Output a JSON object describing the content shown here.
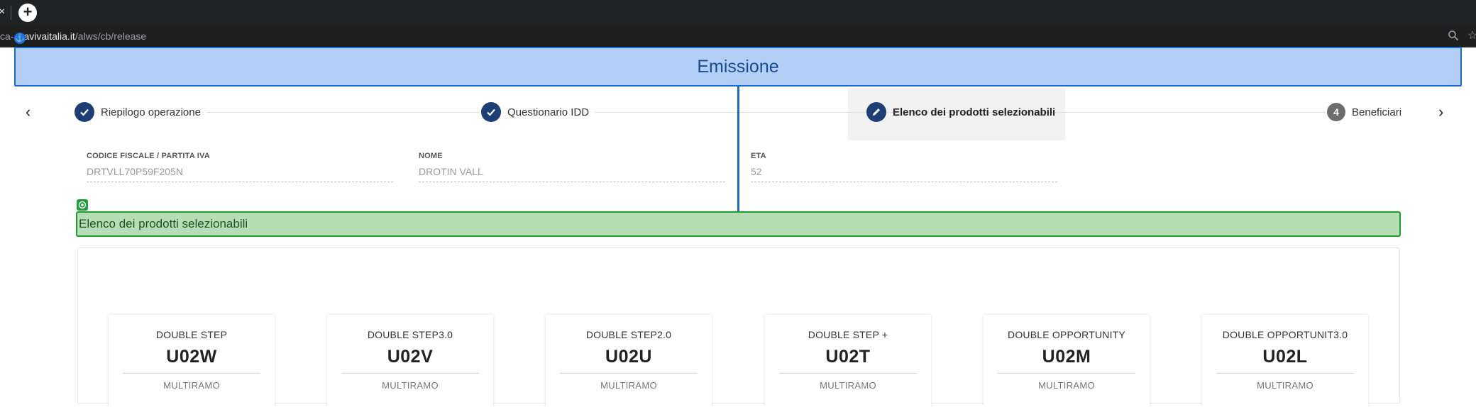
{
  "browser": {
    "close_glyph": "×",
    "newtab_glyph": "+",
    "url_prefix": "ca-",
    "url_host": "avivaitalia.it",
    "url_path": "/alws/cb/release",
    "anchor_glyph": "⚓",
    "star_glyph": "☆"
  },
  "header": {
    "title": "Emissione"
  },
  "stepper": {
    "prev_glyph": "‹",
    "next_glyph": "›",
    "steps": [
      {
        "label": "Riepilogo operazione",
        "state": "done",
        "icon": "check-icon"
      },
      {
        "label": "Questionario IDD",
        "state": "done",
        "icon": "check-icon"
      },
      {
        "label": "Elenco dei prodotti selezionabili",
        "state": "active",
        "icon": "pencil-icon"
      },
      {
        "label": "Beneficiari",
        "state": "todo",
        "number": "4"
      }
    ]
  },
  "customer": {
    "fields": [
      {
        "label": "CODICE FISCALE / PARTITA IVA",
        "value": "DRTVLL70P59F205N"
      },
      {
        "label": "NOME",
        "value": "DROTIN VALL"
      },
      {
        "label": "ETA",
        "value": "52"
      }
    ]
  },
  "section": {
    "title": "Elenco dei prodotti selezionabili"
  },
  "products": [
    {
      "name": "DOUBLE STEP",
      "code": "U02W",
      "type": "MULTIRAMO"
    },
    {
      "name": "DOUBLE STEP3.0",
      "code": "U02V",
      "type": "MULTIRAMO"
    },
    {
      "name": "DOUBLE STEP2.0",
      "code": "U02U",
      "type": "MULTIRAMO"
    },
    {
      "name": "DOUBLE STEP +",
      "code": "U02T",
      "type": "MULTIRAMO"
    },
    {
      "name": "DOUBLE OPPORTUNITY",
      "code": "U02M",
      "type": "MULTIRAMO"
    },
    {
      "name": "DOUBLE OPPORTUNIT3.0",
      "code": "U02L",
      "type": "MULTIRAMO"
    }
  ],
  "colors": {
    "header_bg": "#b3cff5",
    "header_border": "#1a6dc9",
    "step_done": "#1d3f74",
    "section_bg": "#b5deb4",
    "section_border": "#1f9e2f"
  }
}
